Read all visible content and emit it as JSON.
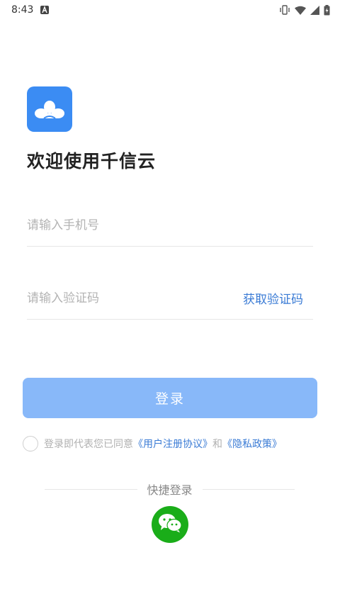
{
  "status_bar": {
    "time": "8:43",
    "icons": [
      "notification-a-icon",
      "vibrate-icon",
      "wifi-icon",
      "signal-icon",
      "battery-charging-icon"
    ]
  },
  "app": {
    "logo_icon": "cloud-logo-icon",
    "welcome_title": "欢迎使用千信云"
  },
  "form": {
    "phone_placeholder": "请输入手机号",
    "code_placeholder": "请输入验证码",
    "get_code_label": "获取验证码",
    "login_label": "登录"
  },
  "agreement": {
    "prefix": "登录即代表您已同意",
    "user_agreement": "《用户注册协议》",
    "joiner": "和",
    "privacy_policy": "《隐私政策》"
  },
  "quick_login": {
    "label": "快捷登录",
    "wechat_icon": "wechat-icon"
  },
  "colors": {
    "accent": "#3b8cf3",
    "login_button": "#88b8f9",
    "link": "#3a7bd5",
    "wechat": "#1aad19"
  }
}
